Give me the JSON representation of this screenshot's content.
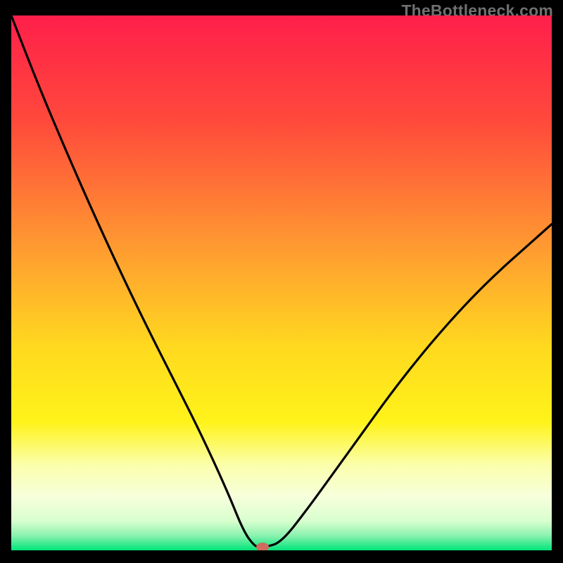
{
  "watermark": "TheBottleneck.com",
  "chart_data": {
    "type": "line",
    "title": "",
    "xlabel": "",
    "ylabel": "",
    "xlim": [
      0,
      100
    ],
    "ylim": [
      0,
      100
    ],
    "series": [
      {
        "name": "curve",
        "x": [
          0,
          5,
          10,
          15,
          20,
          25,
          30,
          35,
          40,
          43,
          45,
          46,
          47,
          50,
          55,
          60,
          65,
          70,
          75,
          80,
          85,
          90,
          95,
          100
        ],
        "y": [
          100,
          87,
          75,
          63.5,
          52.5,
          42,
          32,
          22,
          11,
          3.5,
          0.8,
          0.6,
          0.6,
          1.5,
          8,
          15,
          22,
          29,
          35.5,
          41.5,
          47,
          52,
          56.5,
          61
        ]
      }
    ],
    "marker": {
      "x": 46.5,
      "y": 0.6,
      "color": "#cf6a5e"
    },
    "gradient_stops": [
      {
        "offset": 0.0,
        "color": "#ff1f4b"
      },
      {
        "offset": 0.2,
        "color": "#ff4a3b"
      },
      {
        "offset": 0.45,
        "color": "#ffa030"
      },
      {
        "offset": 0.62,
        "color": "#ffd91f"
      },
      {
        "offset": 0.76,
        "color": "#fff31a"
      },
      {
        "offset": 0.84,
        "color": "#fbffab"
      },
      {
        "offset": 0.9,
        "color": "#f6ffdc"
      },
      {
        "offset": 0.945,
        "color": "#d9ffce"
      },
      {
        "offset": 0.972,
        "color": "#8cf2b0"
      },
      {
        "offset": 1.0,
        "color": "#00e57a"
      }
    ]
  }
}
